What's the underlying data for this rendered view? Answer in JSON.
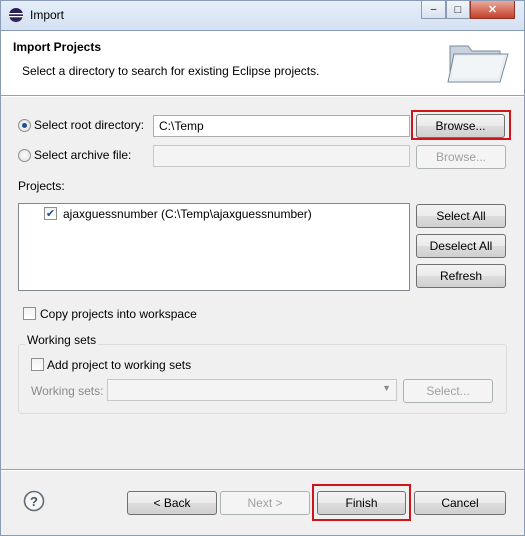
{
  "window": {
    "title": "Import",
    "minimize_glyph": "–",
    "maximize_glyph": "□",
    "close_glyph": "✕"
  },
  "header": {
    "title": "Import Projects",
    "description": "Select a directory to search for existing Eclipse projects.",
    "icon": "folder-icon"
  },
  "source": {
    "root_label": "Select root directory:",
    "root_value": "C:\\Temp",
    "root_selected": true,
    "browse_label": "Browse...",
    "archive_label": "Select archive file:",
    "archive_value": "",
    "archive_browse_label": "Browse..."
  },
  "projects": {
    "label": "Projects:",
    "items": [
      {
        "name": "ajaxguessnumber (C:\\Temp\\ajaxguessnumber)",
        "checked": true
      }
    ],
    "select_all_label": "Select All",
    "deselect_all_label": "Deselect All",
    "refresh_label": "Refresh"
  },
  "copy_into_workspace": {
    "label": "Copy projects into workspace",
    "checked": false
  },
  "working_sets": {
    "group_label": "Working sets",
    "add_label": "Add project to working sets",
    "add_checked": false,
    "sets_label": "Working sets:",
    "sets_value": "",
    "select_label": "Select..."
  },
  "footer": {
    "help_icon": "help-icon",
    "back_label": "< Back",
    "next_label": "Next >",
    "finish_label": "Finish",
    "cancel_label": "Cancel"
  },
  "colors": {
    "highlight": "#d0141b",
    "radio_dot": "#1e4f91"
  }
}
